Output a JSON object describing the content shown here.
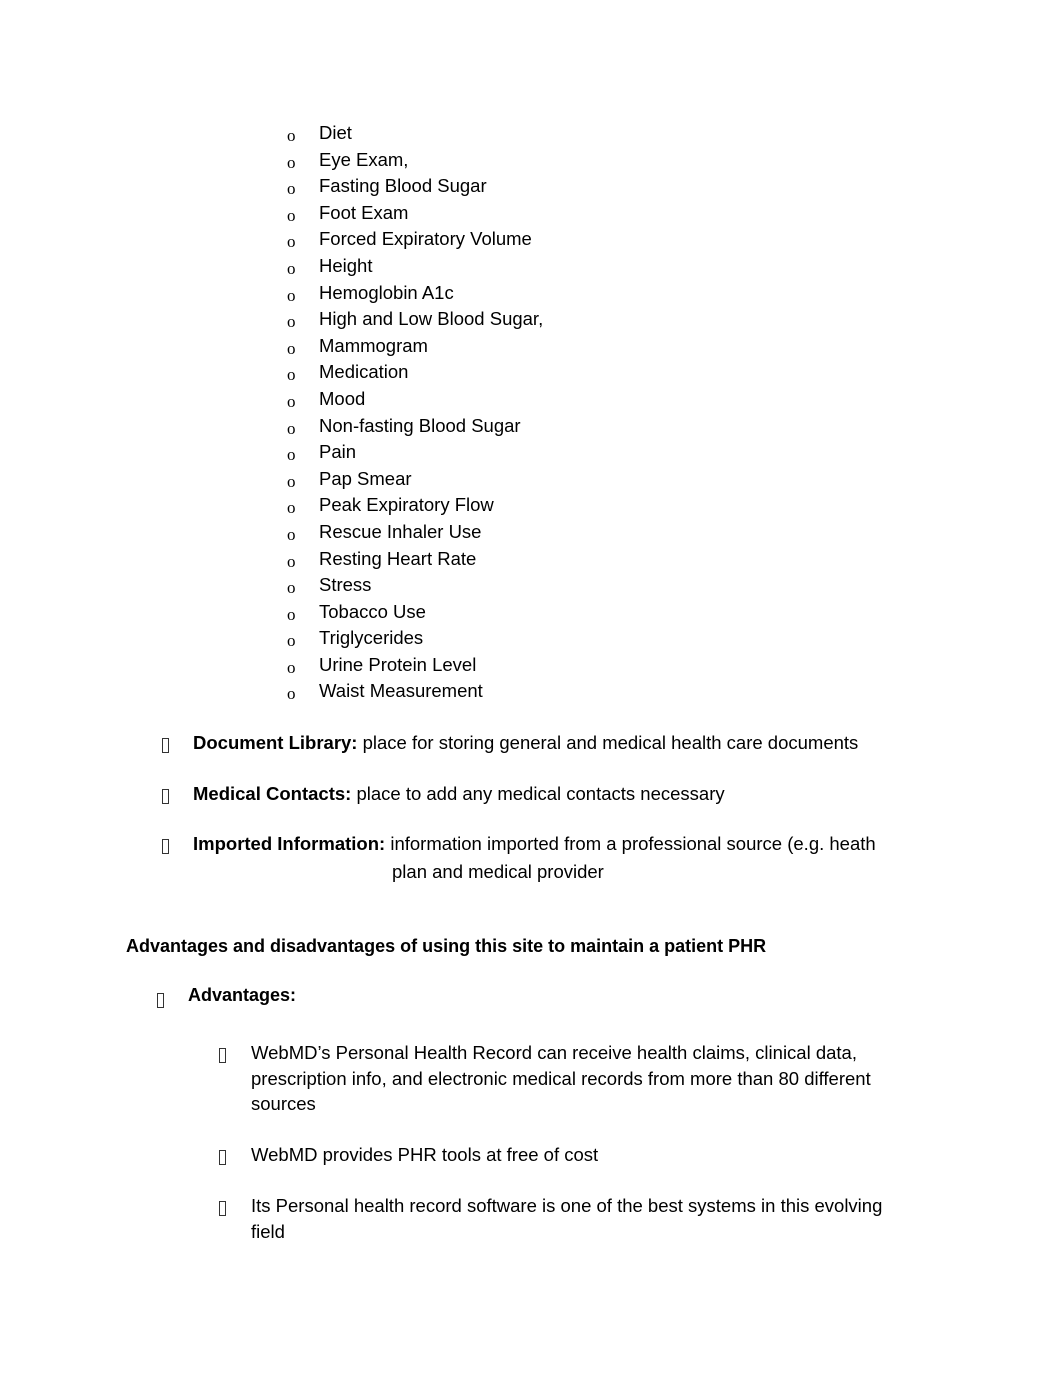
{
  "tracking_items": [
    "Diet",
    "Eye Exam,",
    "Fasting Blood Sugar",
    "Foot Exam",
    "Forced Expiratory Volume",
    "Height",
    "Hemoglobin A1c",
    "High and Low Blood Sugar,",
    "Mammogram",
    "Medication",
    "Mood",
    "Non-fasting Blood Sugar",
    "Pain",
    "Pap Smear",
    "Peak Expiratory Flow",
    "Rescue Inhaler Use",
    "Resting Heart Rate",
    "Stress",
    "Tobacco Use",
    "Triglycerides",
    "Urine Protein Level",
    "Waist Measurement"
  ],
  "sub_bullet_glyph": "o",
  "features": [
    {
      "label": "Document Library:",
      "text": " place for storing general and medical health care documents"
    },
    {
      "label": "Medical Contacts:",
      "text": " place to add any medical contacts necessary"
    },
    {
      "label": "Imported Information:",
      "text": " information imported from a professional source (e.g. heath",
      "continuation": "plan and medical provider"
    }
  ],
  "section_heading": "Advantages and disadvantages of using this site to maintain a patient PHR",
  "advantages": {
    "heading": "Advantages:",
    "items": [
      "WebMD’s Personal Health Record can receive health claims, clinical data, prescription info, and electronic medical records from more than 80 different sources",
      "WebMD provides PHR tools at free of cost",
      "Its Personal health record software is one of the best systems in this evolving field"
    ]
  }
}
